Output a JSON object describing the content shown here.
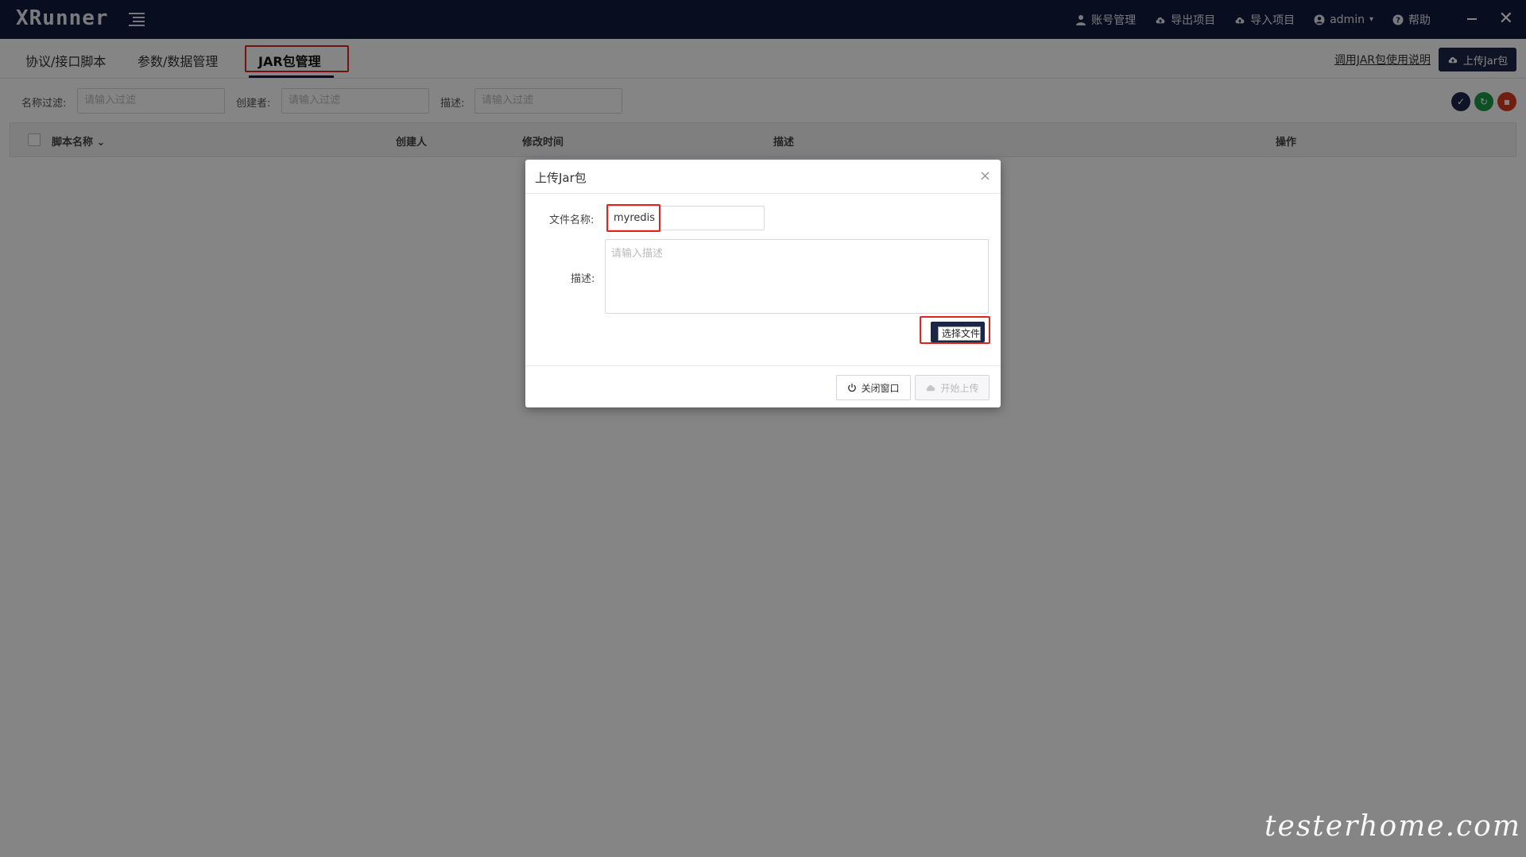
{
  "app": {
    "logo": "XRunner"
  },
  "topbar": {
    "actions": [
      {
        "label": "账号管理",
        "icon": "user-icon"
      },
      {
        "label": "导出项目",
        "icon": "cloud-upload-icon"
      },
      {
        "label": "导入项目",
        "icon": "cloud-upload-icon"
      },
      {
        "label": "admin",
        "icon": "user-circle-icon",
        "caret": "▾"
      },
      {
        "label": "帮助",
        "icon": "help-icon"
      }
    ],
    "minimize": "−",
    "close": "✕"
  },
  "tabs": [
    {
      "label": "协议/接口脚本"
    },
    {
      "label": "参数/数据管理"
    },
    {
      "label": "JAR包管理",
      "active": true
    }
  ],
  "tabbar_right": {
    "link": "调用JAR包使用说明",
    "upload_button": "上传Jar包"
  },
  "filters": {
    "name_label": "名称过滤:",
    "name_placeholder": "请输入过滤",
    "creator_label": "创建者:",
    "creator_placeholder": "请输入过滤",
    "desc_label": "描述:",
    "desc_placeholder": "请输入过滤"
  },
  "table": {
    "columns": [
      "脚本名称",
      "创建人",
      "修改时间",
      "描述",
      "操作"
    ],
    "sort_icon": "⌄"
  },
  "modal": {
    "title": "上传Jar包",
    "close": "×",
    "filename_label": "文件名称:",
    "filename_value": "myredis",
    "desc_label": "描述:",
    "desc_placeholder": "请输入描述",
    "select_file": "选择文件",
    "close_button": "关闭窗口",
    "start_upload_button": "开始上传"
  },
  "watermark": "testerhome.com",
  "colors": {
    "topbar": "#111b3f",
    "primary": "#1b2749",
    "highlight": "#e0241b",
    "check_btn": "#1b2749",
    "refresh_btn": "#1a9a4a",
    "delete_btn": "#d83a1f"
  }
}
